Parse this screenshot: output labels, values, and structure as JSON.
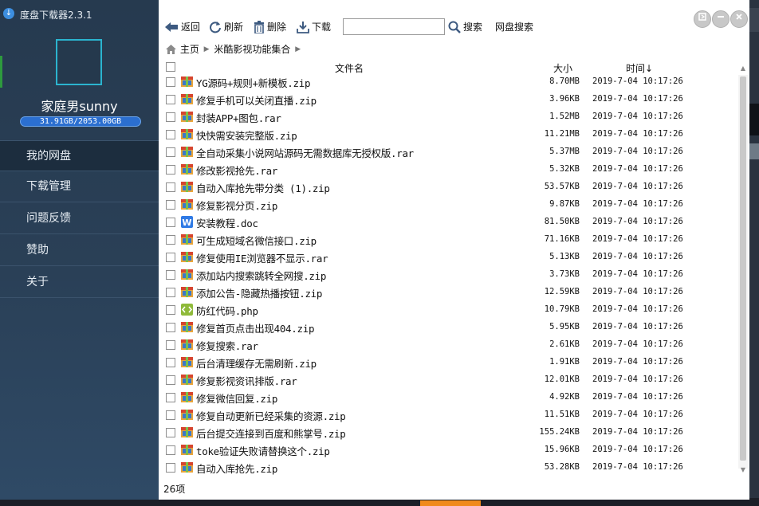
{
  "app": {
    "title": "度盘下载器2.3.1",
    "icon": "download-icon"
  },
  "user": {
    "name": "家庭男sunny",
    "quota": "31.91GB/2053.00GB"
  },
  "nav": {
    "items": [
      {
        "label": "我的网盘",
        "active": true
      },
      {
        "label": "下载管理",
        "active": false
      },
      {
        "label": "问题反馈",
        "active": false
      },
      {
        "label": "赞助",
        "active": false
      },
      {
        "label": "关于",
        "active": false
      }
    ]
  },
  "toolbar": {
    "back": "返回",
    "refresh": "刷新",
    "delete": "删除",
    "download": "下载",
    "search_value": "",
    "search": "搜索",
    "netdisk_search": "网盘搜索"
  },
  "breadcrumb": {
    "home": "主页",
    "folder": "米酷影视功能集合"
  },
  "table": {
    "col_name": "文件名",
    "col_size": "大小",
    "col_time": "时间↓",
    "rows": [
      {
        "name": "YG源码+规则+新模板.zip",
        "size": "8.70MB",
        "time": "2019-7-04 10:17:26",
        "icon": "archive-icon"
      },
      {
        "name": "修复手机可以关闭直播.zip",
        "size": "3.96KB",
        "time": "2019-7-04 10:17:26",
        "icon": "archive-icon"
      },
      {
        "name": "封装APP+图包.rar",
        "size": "1.52MB",
        "time": "2019-7-04 10:17:26",
        "icon": "archive-icon"
      },
      {
        "name": "快快需安装完整版.zip",
        "size": "11.21MB",
        "time": "2019-7-04 10:17:26",
        "icon": "archive-icon"
      },
      {
        "name": "全自动采集小说网站源码无需数据库无授权版.rar",
        "size": "5.37MB",
        "time": "2019-7-04 10:17:26",
        "icon": "archive-icon"
      },
      {
        "name": "修改影视抢先.rar",
        "size": "5.32KB",
        "time": "2019-7-04 10:17:26",
        "icon": "archive-icon"
      },
      {
        "name": "自动入库抢先带分类 (1).zip",
        "size": "53.57KB",
        "time": "2019-7-04 10:17:26",
        "icon": "archive-icon"
      },
      {
        "name": "修复影视分页.zip",
        "size": "9.87KB",
        "time": "2019-7-04 10:17:26",
        "icon": "archive-icon"
      },
      {
        "name": "安装教程.doc",
        "size": "81.50KB",
        "time": "2019-7-04 10:17:26",
        "icon": "word-doc-icon"
      },
      {
        "name": "可生成短域名微信接口.zip",
        "size": "71.16KB",
        "time": "2019-7-04 10:17:26",
        "icon": "archive-icon"
      },
      {
        "name": "修复使用IE浏览器不显示.rar",
        "size": "5.13KB",
        "time": "2019-7-04 10:17:26",
        "icon": "archive-icon"
      },
      {
        "name": "添加站内搜索跳转全网搜.zip",
        "size": "3.73KB",
        "time": "2019-7-04 10:17:26",
        "icon": "archive-icon"
      },
      {
        "name": "添加公告-隐藏热播按钮.zip",
        "size": "12.59KB",
        "time": "2019-7-04 10:17:26",
        "icon": "archive-icon"
      },
      {
        "name": "防红代码.php",
        "size": "10.79KB",
        "time": "2019-7-04 10:17:26",
        "icon": "code-file-icon"
      },
      {
        "name": "修复首页点击出现404.zip",
        "size": "5.95KB",
        "time": "2019-7-04 10:17:26",
        "icon": "archive-icon"
      },
      {
        "name": "修复搜索.rar",
        "size": "2.61KB",
        "time": "2019-7-04 10:17:26",
        "icon": "archive-icon"
      },
      {
        "name": "后台清理缓存无需刷新.zip",
        "size": "1.91KB",
        "time": "2019-7-04 10:17:26",
        "icon": "archive-icon"
      },
      {
        "name": "修复影视资讯排版.rar",
        "size": "12.01KB",
        "time": "2019-7-04 10:17:26",
        "icon": "archive-icon"
      },
      {
        "name": "修复微信回复.zip",
        "size": "4.92KB",
        "time": "2019-7-04 10:17:26",
        "icon": "archive-icon"
      },
      {
        "name": "修复自动更新已经采集的资源.zip",
        "size": "11.51KB",
        "time": "2019-7-04 10:17:26",
        "icon": "archive-icon"
      },
      {
        "name": "后台提交连接到百度和熊掌号.zip",
        "size": "155.24KB",
        "time": "2019-7-04 10:17:26",
        "icon": "archive-icon"
      },
      {
        "name": "toke验证失败请替换这个.zip",
        "size": "15.96KB",
        "time": "2019-7-04 10:17:26",
        "icon": "archive-icon"
      },
      {
        "name": "自动入库抢先.zip",
        "size": "53.28KB",
        "time": "2019-7-04 10:17:26",
        "icon": "archive-icon"
      }
    ]
  },
  "footer": {
    "count": "26项"
  },
  "colors": {
    "sidebar": "#263a4f",
    "accent": "#2b6fd0",
    "avatar_border": "#2bb4cf"
  }
}
